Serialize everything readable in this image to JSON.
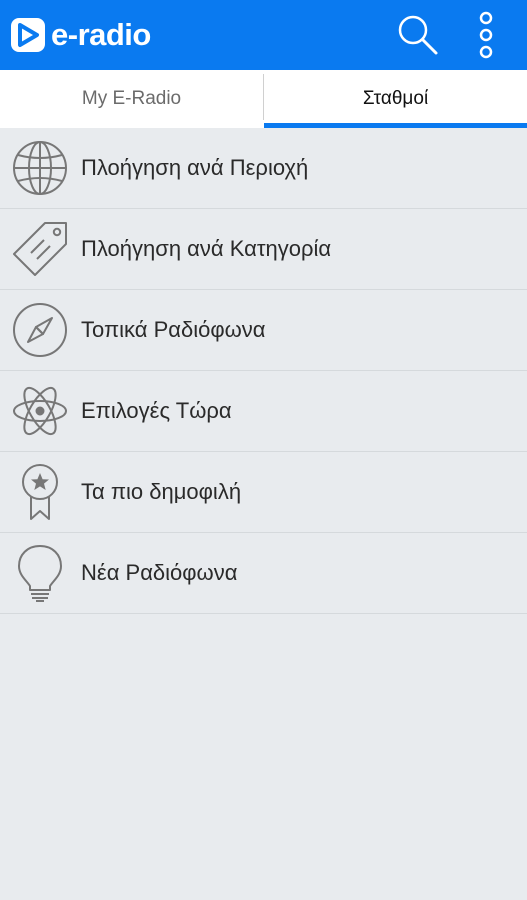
{
  "appbar": {
    "logo_text": "e-radio",
    "background": "#0a7af0",
    "icons": [
      "play-logo-icon",
      "search-icon",
      "more-vert-icon"
    ]
  },
  "tabs": [
    {
      "label": "My E-Radio",
      "active": false
    },
    {
      "label": "Σταθμοί",
      "active": true
    }
  ],
  "menu": {
    "items": [
      {
        "label": "Πλοήγηση ανά Περιοχή",
        "icon": "globe-icon"
      },
      {
        "label": "Πλοήγηση ανά Κατηγορία",
        "icon": "tag-icon"
      },
      {
        "label": "Τοπικά Ραδιόφωνα",
        "icon": "compass-icon"
      },
      {
        "label": "Επιλογές Τώρα",
        "icon": "atom-icon"
      },
      {
        "label": "Τα πιο δημοφιλή",
        "icon": "award-ribbon-icon"
      },
      {
        "label": "Νέα Ραδιόφωνα",
        "icon": "lightbulb-icon"
      }
    ]
  }
}
